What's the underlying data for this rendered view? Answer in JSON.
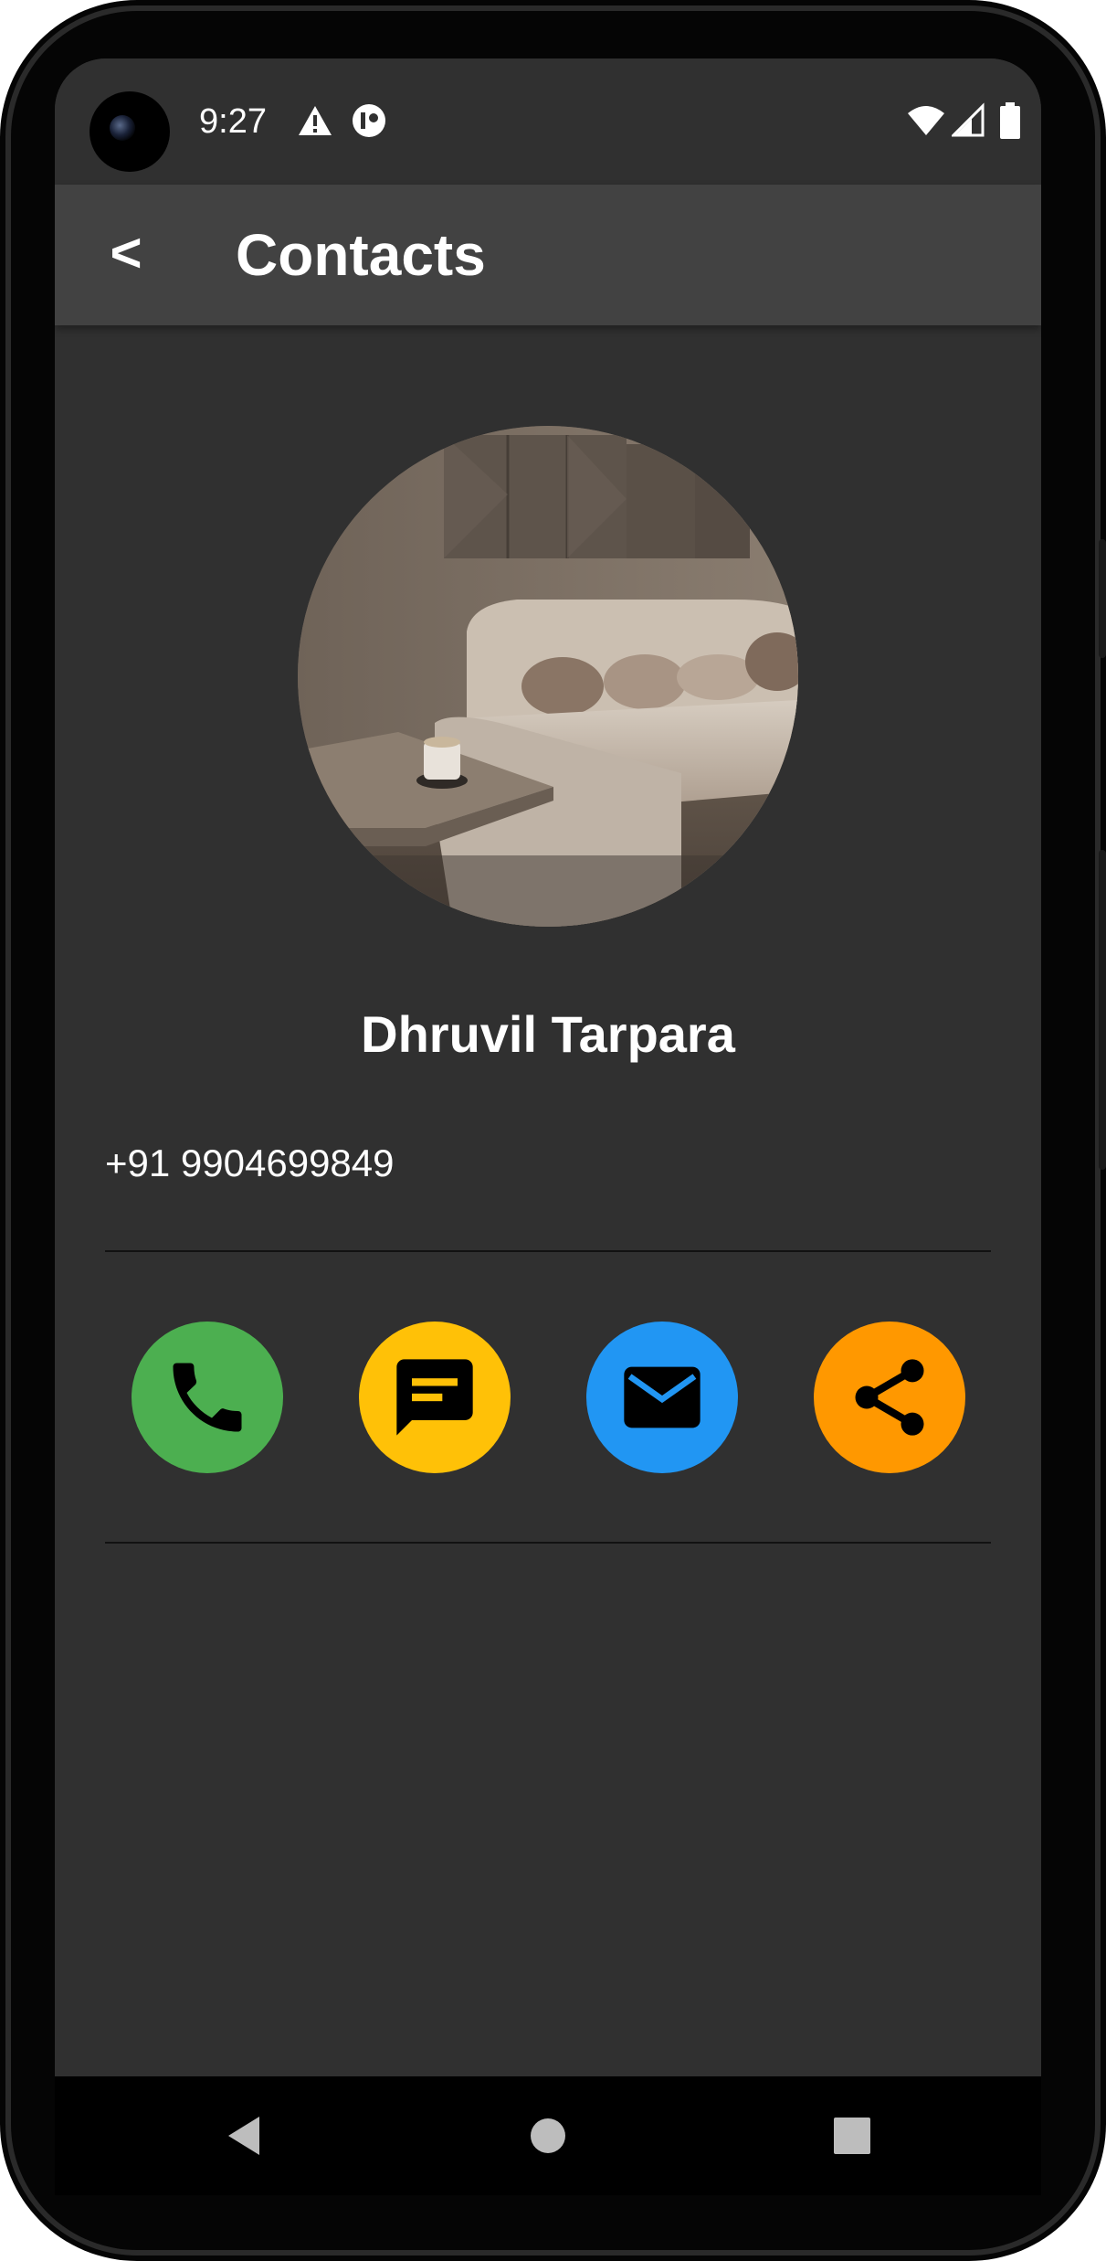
{
  "status_bar": {
    "time": "9:27",
    "icons": [
      "warning-icon",
      "notification-dot-icon",
      "wifi-icon",
      "signal-icon",
      "battery-icon"
    ]
  },
  "app_bar": {
    "back_label": "<",
    "title": "Contacts"
  },
  "contact": {
    "name": "Dhruvil Tarpara",
    "phone": "+91 9904699849"
  },
  "actions": [
    {
      "name": "call",
      "icon": "phone-icon",
      "color": "#4CAF50"
    },
    {
      "name": "message",
      "icon": "message-icon",
      "color": "#FFC107"
    },
    {
      "name": "email",
      "icon": "email-icon",
      "color": "#2196F3"
    },
    {
      "name": "share",
      "icon": "share-icon",
      "color": "#FF9800"
    }
  ],
  "nav_bar": {
    "buttons": [
      "back-triangle-icon",
      "home-circle-icon",
      "recents-square-icon"
    ]
  },
  "colors": {
    "background": "#303030",
    "app_bar": "#424242",
    "text": "#FFFFFF"
  }
}
